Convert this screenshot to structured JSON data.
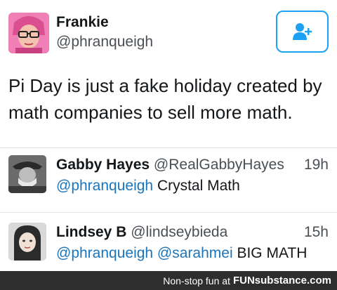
{
  "tweet": {
    "name": "Frankie",
    "handle": "@phranqueigh",
    "text": "Pi Day is just a fake holiday created by math companies to sell more math.",
    "follow_icon": "follow-user-icon"
  },
  "replies": [
    {
      "name": "Gabby Hayes",
      "handle": "@RealGabbyHayes",
      "time": "19h",
      "mention": "@phranqueigh",
      "text": "Crystal Math"
    },
    {
      "name": "Lindsey B",
      "handle": "@lindseybieda",
      "time": "15h",
      "mention": "@phranqueigh @sarahmei",
      "text": "BIG MATH"
    }
  ],
  "footer": {
    "prefix": "Non-stop fun at",
    "brand": "FUNsubstance.com"
  },
  "colors": {
    "accent": "#1da1f2",
    "mention": "#1b75bb",
    "footer_bg": "#2e2e2e"
  }
}
